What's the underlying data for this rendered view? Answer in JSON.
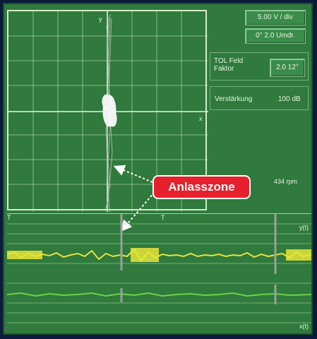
{
  "controls": {
    "volts_per_div": "5.00 V / div",
    "rotation": "0° 2.0 Umdr.",
    "tol_label": "TOL Feld\nFaktor",
    "tol_value": "2.0  12°",
    "gain_label": "Verstärkung",
    "gain_value": "100 dB",
    "rpm": "434 rpm"
  },
  "axes": {
    "xy_y": "y",
    "xy_x": "x",
    "t_left": "T",
    "t_mid": "T",
    "yt": "y(t)",
    "xt": "x(t)"
  },
  "callout": {
    "text": "Anlasszone"
  },
  "colors": {
    "background": "#2f7a3c",
    "grid": "#d6ecc9",
    "trace_y": "#e6e53a",
    "trace_x": "#6fd14a",
    "callout": "#e7202d"
  }
}
